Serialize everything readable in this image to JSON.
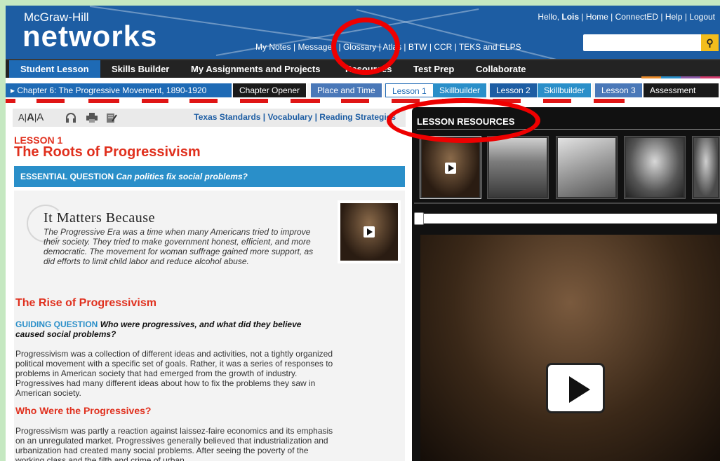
{
  "brand": {
    "top": "McGraw-Hill",
    "main": "networks"
  },
  "user": {
    "hello": "Hello, ",
    "name": "Lois",
    "links": [
      "Home",
      "ConnectED",
      "Help",
      "Logout"
    ]
  },
  "top_links": "My Notes | Messages | Glossary | Atlas | BTW | CCR | TEKS and ELPS",
  "search": {
    "placeholder": "",
    "icon": "search-icon"
  },
  "main_nav": [
    "Student Lesson",
    "Skills Builder",
    "My Assignments and Projects",
    "Resources",
    "Test Prep",
    "Collaborate"
  ],
  "chapter": {
    "label": "Chapter 6: The Progressive Movement, 1890-1920",
    "tabs": [
      "Chapter Opener",
      "Place and Time",
      "Lesson 1",
      "Skillbuilder",
      "Lesson 2",
      "Skillbuilder",
      "Lesson 3",
      "Assessment"
    ],
    "active_tab": "Lesson 1"
  },
  "toolbar": {
    "font_small": "A",
    "font_mid": "A",
    "font_large": "A",
    "links": "Texas Standards | Vocabulary | Reading Strategies",
    "icons": [
      "headphones-icon",
      "print-icon",
      "notes-icon"
    ]
  },
  "lesson": {
    "number": "LESSON 1",
    "title": "The Roots of Progressivism",
    "eq_label": "ESSENTIAL QUESTION",
    "eq_text": "Can politics fix social problems?",
    "imb_title": "It Matters Because",
    "imb_text": "The Progressive Era was a time when many Americans tried to improve their society. They tried to make government honest, efficient, and more democratic. The movement for woman suffrage gained more support, as did efforts to limit child labor and reduce alcohol abuse.",
    "section_title": "The Rise of Progressivism",
    "gq_label": "GUIDING QUESTION",
    "gq_text": "Who were progressives, and what did they believe caused social problems?",
    "p1": "Progressivism was a collection of different ideas and activities, not a tightly organized political movement with a specific set of goals. Rather, it was a series of responses to problems in American society that had emerged from the growth of industry. Progressives had many different ideas about how to fix the problems they saw in American society.",
    "sub_title": "Who Were the Progressives?",
    "p2": "Progressivism was partly a reaction against laissez-faire economics and its emphasis on an unregulated market. Progressives generally believed that industrialization and urbanization had created many social problems. After seeing the poverty of the working class and the filth and crime of urban"
  },
  "resources": {
    "title": "LESSON RESOURCES",
    "thumbs": [
      "video",
      "photo",
      "photo",
      "portrait",
      "portrait"
    ]
  },
  "colors": {
    "header": "#1d5da3",
    "accent_blue": "#1e6ab5",
    "teal": "#2a8fc9",
    "red": "#e0301e",
    "annotation": "#ee0000"
  }
}
